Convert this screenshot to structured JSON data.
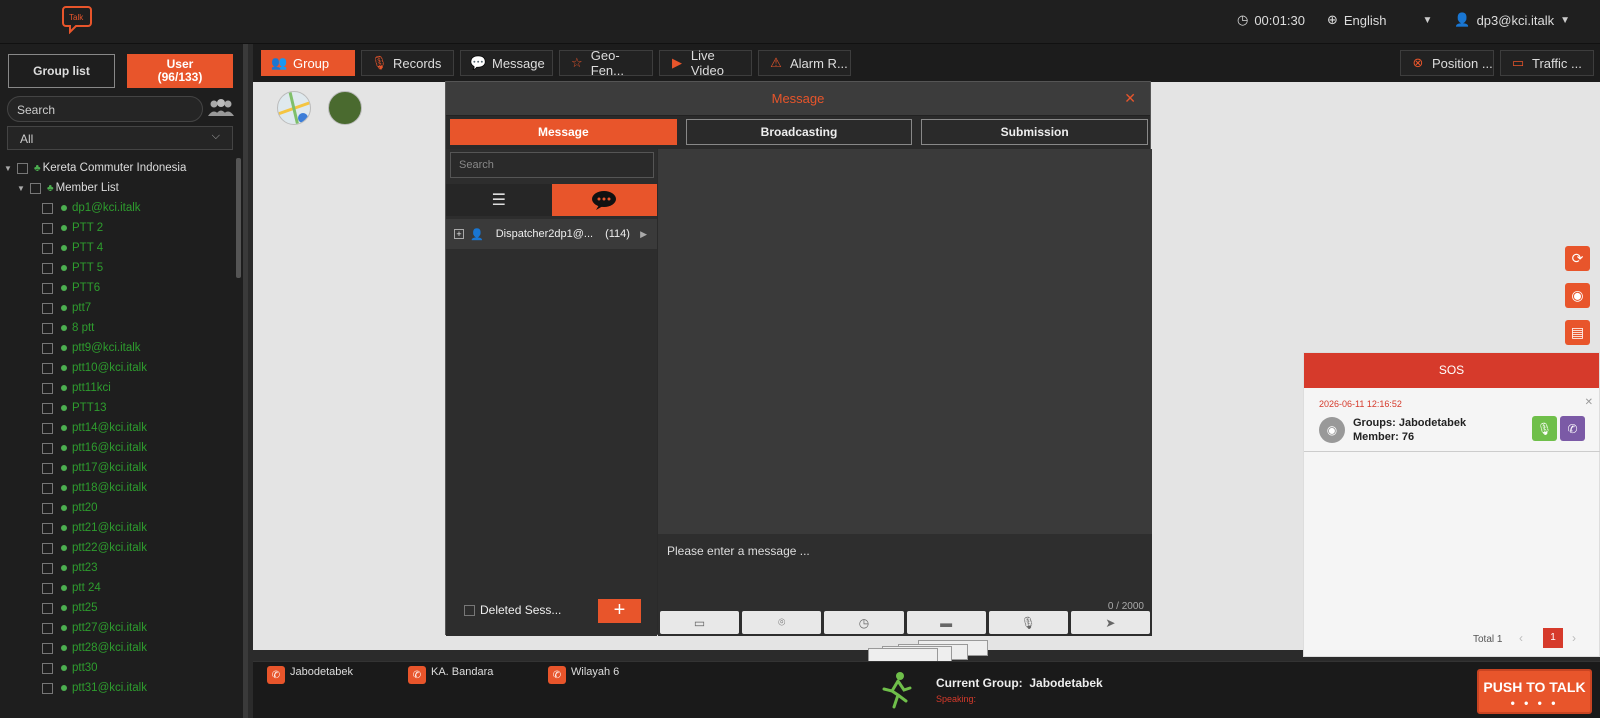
{
  "topbar": {
    "timer": "00:01:30",
    "language": "English",
    "user": "dp3@kci.italk"
  },
  "left": {
    "tab_group": "Group list",
    "tab_user_line1": "User",
    "tab_user_line2": "(96/133)",
    "search_placeholder": "Search",
    "filter_value": "All",
    "org_name": "Kereta Commuter Indonesia",
    "member_list_label": "Member List",
    "members": [
      "dp1@kci.italk",
      "PTT 2",
      "PTT 4",
      "PTT 5",
      "PTT6",
      "ptt7",
      "8 ptt",
      "ptt9@kci.italk",
      "ptt10@kci.italk",
      "ptt11kci",
      "PTT13",
      "ptt14@kci.italk",
      "ptt16@kci.italk",
      "ptt17@kci.italk",
      "ptt18@kci.italk",
      "ptt20",
      "ptt21@kci.italk",
      "ptt22@kci.italk",
      "ptt23",
      "ptt 24",
      "ptt25",
      "ptt27@kci.italk",
      "ptt28@kci.italk",
      "ptt30",
      "ptt31@kci.italk"
    ]
  },
  "nav": {
    "group": "Group",
    "records": "Records",
    "message": "Message",
    "geofence": "Geo-Fen...",
    "live_video": "Live Video",
    "alarm": "Alarm R...",
    "position": "Position ...",
    "traffic": "Traffic ..."
  },
  "message_window": {
    "title": "Message",
    "tab_message": "Message",
    "tab_broadcasting": "Broadcasting",
    "tab_submission": "Submission",
    "search_placeholder": "Search",
    "session_name": "Dispatcher2dp1@...",
    "session_count": "(114)",
    "deleted_sessions": "Deleted Sess...",
    "input_placeholder": "Please enter a message ...",
    "char_count": "0 / 2000"
  },
  "sos": {
    "title": "SOS",
    "time": "2026-06-11 12:16:52",
    "groups_label": "Groups:",
    "groups_value": "Jabodetabek",
    "member_label": "Member:",
    "member_value": "76",
    "total": "Total 1",
    "page": "1"
  },
  "bottom": {
    "group1": "Jabodetabek",
    "group2": "KA. Bandara",
    "group3": "Wilayah 6",
    "current_group_label": "Current Group:",
    "current_group_value": "Jabodetabek",
    "speaking": "Speaking:",
    "ptt": "PUSH TO TALK"
  },
  "colors": {
    "accent": "#e8552b",
    "sos_red": "#d63a2b",
    "online_green": "#2e9d2e"
  }
}
